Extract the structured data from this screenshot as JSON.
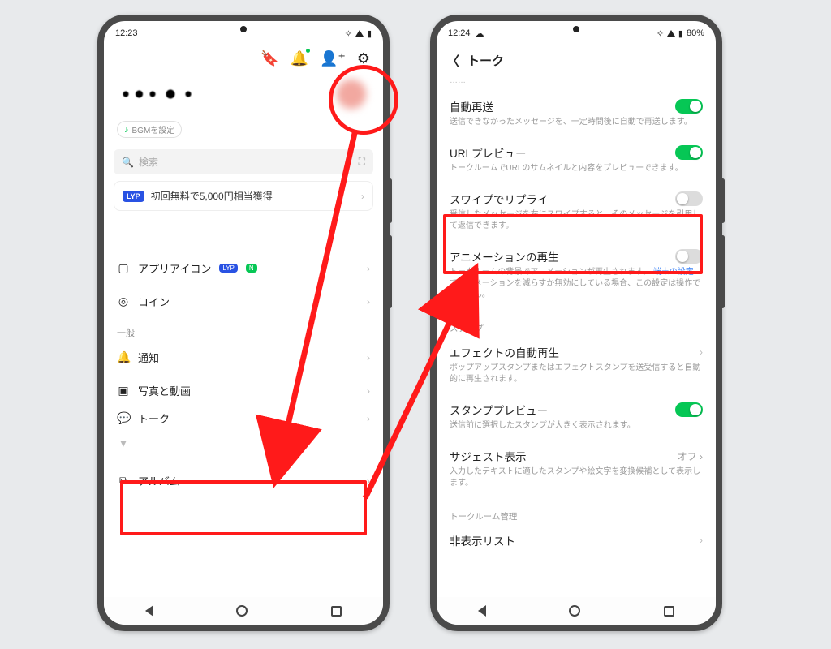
{
  "left": {
    "status": {
      "time": "12:23",
      "battery_icons": "◢▮"
    },
    "search_placeholder": "検索",
    "bgm": "BGMを設定",
    "promo": "初回無料で5,000円相当獲得",
    "lyp": "LYP",
    "menu": {
      "app_icon": "アプリアイコン",
      "coin": "コイン",
      "section_general": "一般",
      "notifications": "通知",
      "photo_video": "写真と動画",
      "talk": "トーク",
      "album": "アルバム"
    },
    "badges": {
      "lyp": "LYP",
      "n": "N"
    }
  },
  "right": {
    "status": {
      "time": "12:24",
      "battery": "80%",
      "cloud": "☁"
    },
    "page_title": "トーク",
    "settings": {
      "auto_resend": {
        "title": "自動再送",
        "desc": "送信できなかったメッセージを、一定時間後に自動で再送します。"
      },
      "url_preview": {
        "title": "URLプレビュー",
        "desc": "トークルームでURLのサムネイルと内容をプレビューできます。"
      },
      "swipe_reply": {
        "title": "スワイプでリプライ",
        "desc": "受信したメッセージを左にスワイプすると、そのメッセージを引用して返信できます。"
      },
      "animation": {
        "title": "アニメーションの再生",
        "desc_a": "トークルームの背景でアニメーションが再生されます。",
        "link": "端末の設定",
        "desc_b": "でアニメーションを減らすか無効にしている場合、この設定は操作できません。"
      },
      "section_stamp": "スタンプ",
      "effect_autoplay": {
        "title": "エフェクトの自動再生",
        "desc": "ポップアップスタンプまたはエフェクトスタンプを送受信すると自動的に再生されます。"
      },
      "stamp_preview": {
        "title": "スタンププレビュー",
        "desc": "送信前に選択したスタンプが大きく表示されます。"
      },
      "suggest": {
        "title": "サジェスト表示",
        "value": "オフ",
        "desc": "入力したテキストに適したスタンプや絵文字を変換候補として表示します。"
      },
      "section_room": "トークルーム管理",
      "hidden_list": {
        "title": "非表示リスト"
      }
    }
  }
}
